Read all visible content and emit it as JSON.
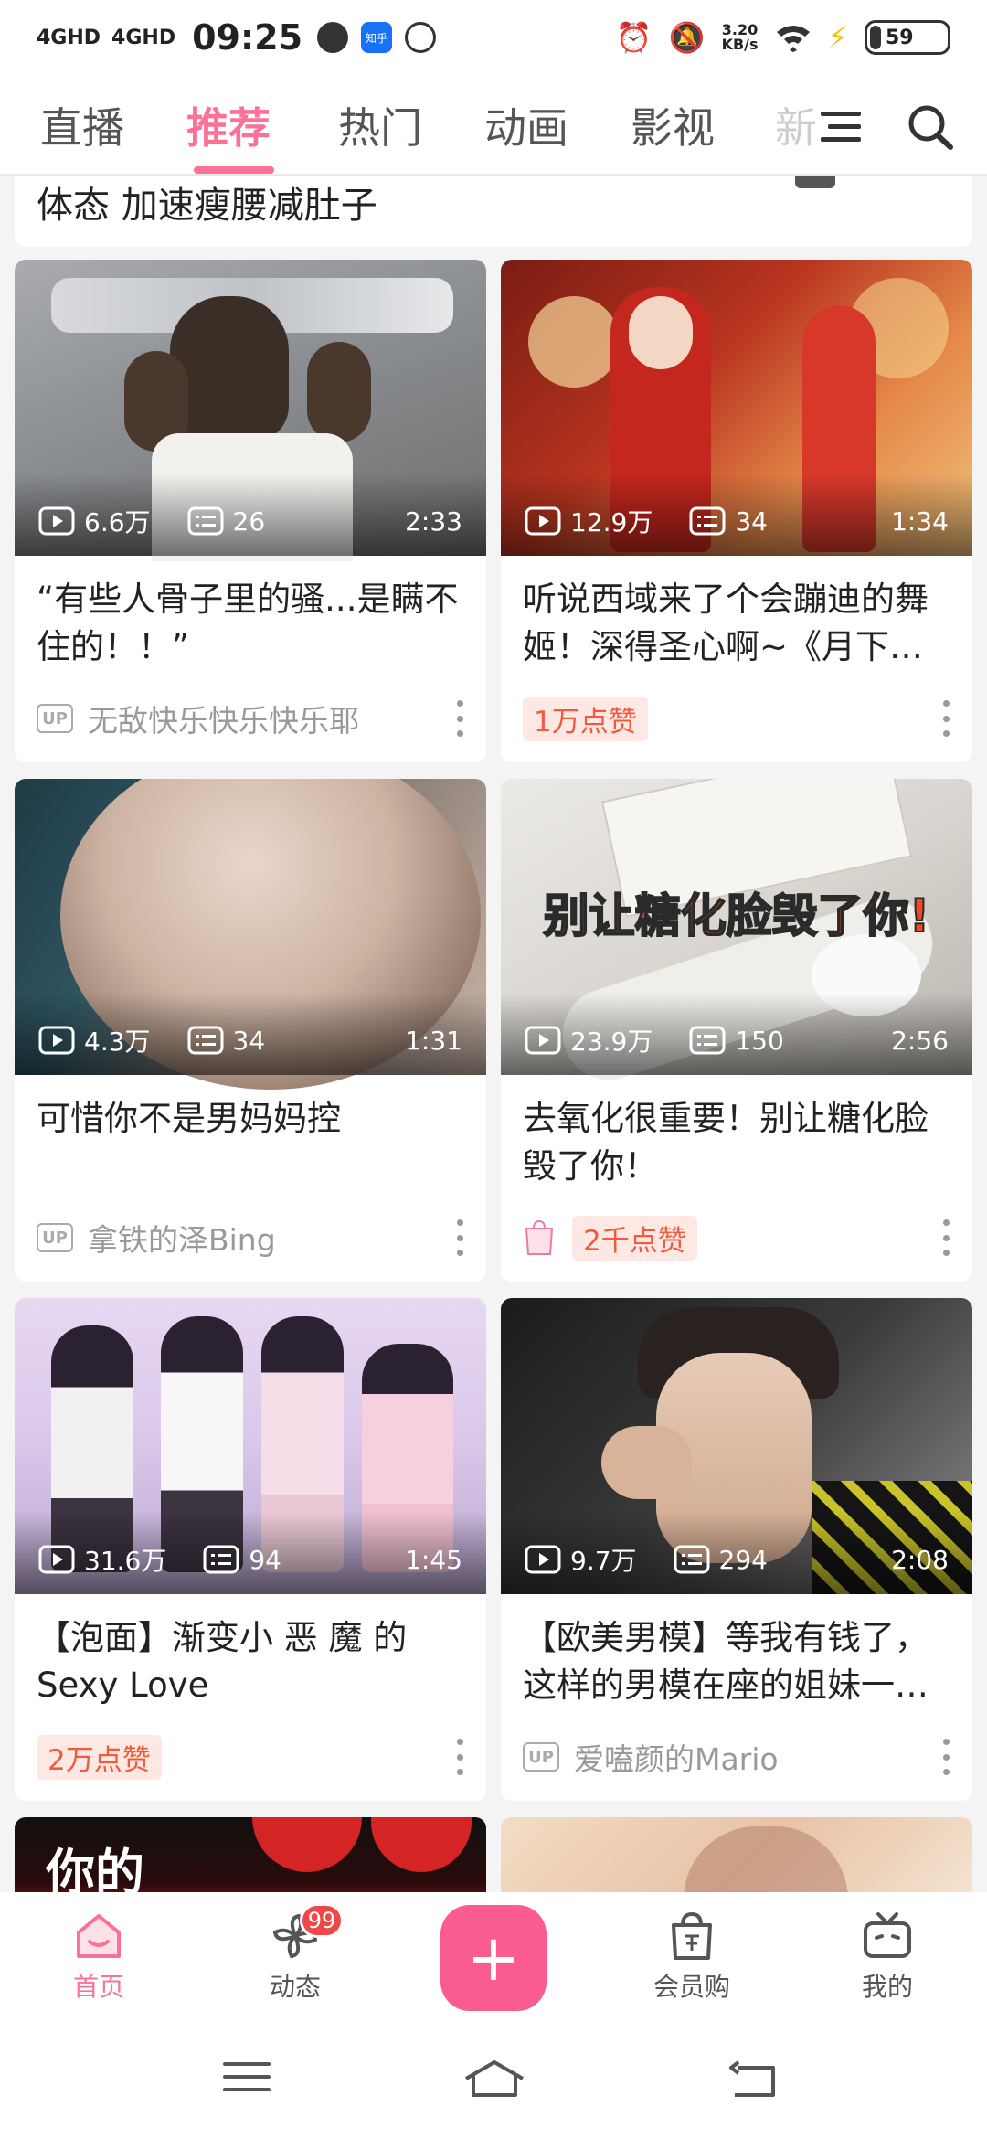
{
  "status_bar": {
    "signal1": "4GHD",
    "signal2": "4GHD",
    "time": "09:25",
    "app_icon_zhihu": "知乎",
    "net_speed": "3.20",
    "net_unit": "KB/s",
    "battery": "59"
  },
  "nav": {
    "tabs": [
      "直播",
      "推荐",
      "热门",
      "动画",
      "影视",
      "新"
    ],
    "active_index": 1,
    "accent": "#fb7299"
  },
  "feed": {
    "partial_title": "体态 加速瘦腰减肚子",
    "cards": [
      {
        "views": "6.6万",
        "danmaku": "26",
        "duration": "2:33",
        "title": "“有些人骨子里的骚...是瞒不住的！！”",
        "meta_type": "up",
        "author": "无敌快乐快乐快乐耶"
      },
      {
        "views": "12.9万",
        "danmaku": "34",
        "duration": "1:34",
        "title": "听说西域来了个会蹦迪的舞姬！深得圣心啊~《月下…",
        "meta_type": "like",
        "like": "1万点赞"
      },
      {
        "views": "4.3万",
        "danmaku": "34",
        "duration": "1:31",
        "title": "可惜你不是男妈妈控",
        "meta_type": "up",
        "author": "拿铁的泽Bing"
      },
      {
        "views": "23.9万",
        "danmaku": "150",
        "duration": "2:56",
        "title": "去氧化很重要！别让糖化脸毁了你！",
        "meta_type": "like",
        "like": "2千点赞",
        "thumb_text": "别让糖化脸毁了你!"
      },
      {
        "views": "31.6万",
        "danmaku": "94",
        "duration": "1:45",
        "title": "【泡面】渐变小 恶 魔 的 Sexy Love",
        "meta_type": "like",
        "like": "2万点赞"
      },
      {
        "views": "9.7万",
        "danmaku": "294",
        "duration": "2:08",
        "title": "【欧美男模】等我有钱了，这样的男模在座的姐妹一…",
        "meta_type": "up",
        "author": "爱嗑颜的Mario"
      }
    ],
    "partial_thumb_text": "你的",
    "up_label": "UP"
  },
  "tabbar": {
    "items": [
      "首页",
      "动态",
      "会员购",
      "我的"
    ],
    "badge": "99",
    "plus": "+"
  }
}
